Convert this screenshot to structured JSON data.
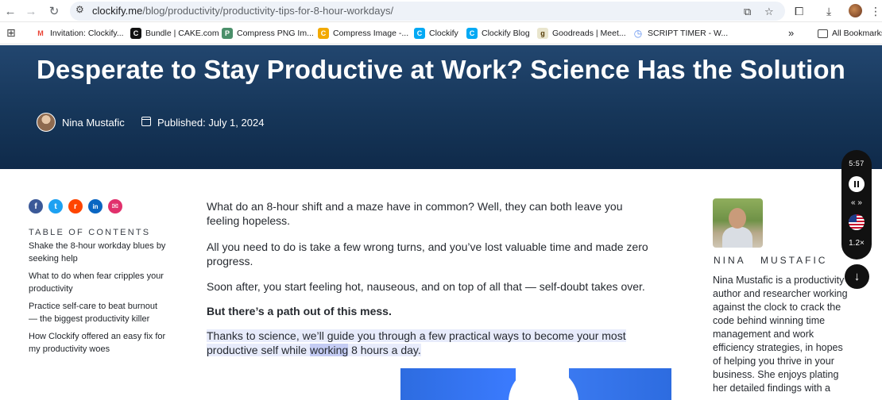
{
  "browser": {
    "url_host": "clockify.me",
    "url_path": "/blog/productivity/productivity-tips-for-8-hour-workdays/",
    "bookmarks": [
      {
        "label": "Invitation: Clockify...",
        "icon": "gmail-icon",
        "color": "#ea4335",
        "glyph": "M"
      },
      {
        "label": "Bundle | CAKE.com",
        "icon": "cake-icon",
        "color": "#111111",
        "glyph": "C"
      },
      {
        "label": "Compress PNG Im...",
        "icon": "panda-icon",
        "color": "#4a8f6a",
        "glyph": "P"
      },
      {
        "label": "Compress Image -...",
        "icon": "compress-icon",
        "color": "#f2a900",
        "glyph": "C"
      },
      {
        "label": "Clockify",
        "icon": "clockify-icon",
        "color": "#03a9f4",
        "glyph": "C"
      },
      {
        "label": "Clockify Blog",
        "icon": "clockify-icon",
        "color": "#03a9f4",
        "glyph": "C"
      },
      {
        "label": "Goodreads | Meet...",
        "icon": "goodreads-icon",
        "color": "#e9e5cd",
        "glyph": "g"
      },
      {
        "label": "SCRIPT TIMER - W...",
        "icon": "timer-icon",
        "color": "#5b8def",
        "glyph": "◷"
      }
    ],
    "all_bookmarks_label": "All Bookmarks",
    "more_bookmarks_label": "»"
  },
  "hero": {
    "title": "Desperate to Stay Productive at Work? Science Has the Solution",
    "author": "Nina Mustafic",
    "published": "Published: July 1, 2024"
  },
  "social": [
    {
      "name": "facebook-icon",
      "color": "#3b5998",
      "glyph": "f"
    },
    {
      "name": "twitter-icon",
      "color": "#1da1f2",
      "glyph": "t"
    },
    {
      "name": "reddit-icon",
      "color": "#ff4500",
      "glyph": "r"
    },
    {
      "name": "linkedin-icon",
      "color": "#0a66c2",
      "glyph": "in"
    },
    {
      "name": "email-icon",
      "color": "#e1306c",
      "glyph": "✉"
    }
  ],
  "toc": {
    "title": "TABLE OF CONTENTS",
    "items": [
      "Shake the 8-hour workday blues by seeking help",
      "What to do when fear cripples your productivity",
      "Practice self-care to beat burnout — the biggest productivity killer",
      "How Clockify offered an easy fix for my productivity woes"
    ]
  },
  "article": {
    "p1": "What do an 8-hour shift and a maze have in common? Well, they can both leave you feeling hopeless.",
    "p2": "All you need to do is take a few wrong turns, and you’ve lost valuable time and made zero progress.",
    "p3": "Soon after, you start feeling hot, nauseous, and on top of all that — self-doubt takes over.",
    "p4": "But there’s a path out of this mess.",
    "p5_before": "Thanks to science, we’ll guide you through a few practical ways to become your most productive self while ",
    "p5_highlight": "working",
    "p5_after": " 8 hours a day."
  },
  "sidebar": {
    "author_label": "NINA   MUSTAFIC",
    "bio": "Nina Mustafic is a productivity author and researcher working against the clock to crack the code behind winning time management and work efficiency strategies, in hopes of helping you thrive in your business. She enjoys plating her detailed findings with a"
  },
  "player": {
    "time": "5:57",
    "skip": "« »",
    "speed": "1.2×"
  },
  "colors": {
    "hero_top": "#22466f",
    "hero_bottom": "#0f2a4a",
    "highlight": "#e7ebfb",
    "highlight_active": "#c4ccf4"
  }
}
